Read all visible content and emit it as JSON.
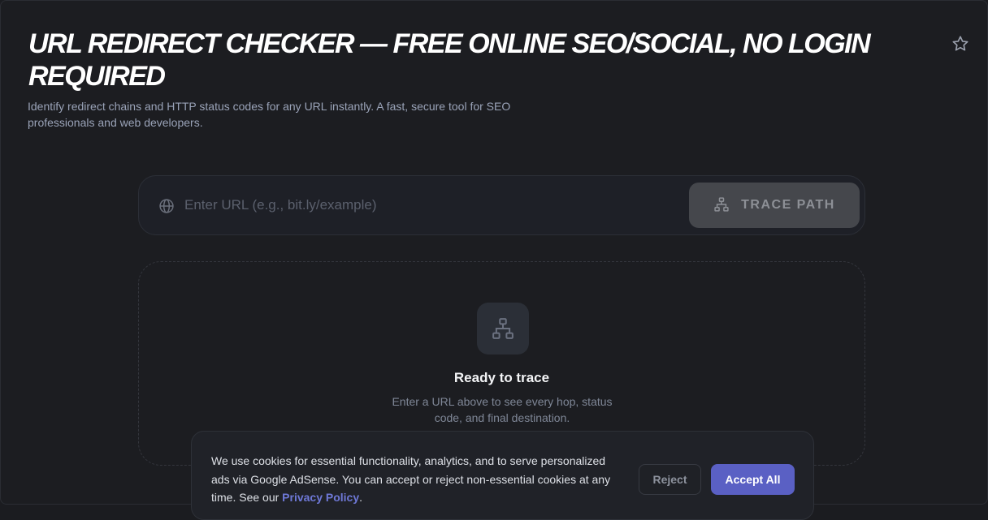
{
  "header": {
    "title": "URL REDIRECT CHECKER — FREE ONLINE SEO/SOCIAL, NO LOGIN REQUIRED",
    "subtitle": "Identify redirect chains and HTTP status codes for any URL instantly. A fast, secure tool for SEO professionals and web developers.",
    "favorite_icon": "star-icon"
  },
  "search": {
    "placeholder": "Enter URL (e.g., bit.ly/example)",
    "value": "",
    "globe_icon": "globe-icon",
    "button_icon": "sitemap-icon",
    "button_label": "TRACE PATH"
  },
  "empty_state": {
    "icon": "sitemap-icon",
    "title": "Ready to trace",
    "description": "Enter a URL above to see every hop, status code, and final destination."
  },
  "cookie_banner": {
    "text": "We use cookies for essential functionality, analytics, and to serve personalized ads via Google AdSense. You can accept or reject non-essential cookies at any time. See our ",
    "link_label": "Privacy Policy",
    "text_end": ".",
    "reject_label": "Reject",
    "accept_label": "Accept All"
  },
  "colors": {
    "background": "#1c1d21",
    "accent": "#5a60c4",
    "link": "#6e78d6",
    "button_disabled": "#45474c"
  }
}
